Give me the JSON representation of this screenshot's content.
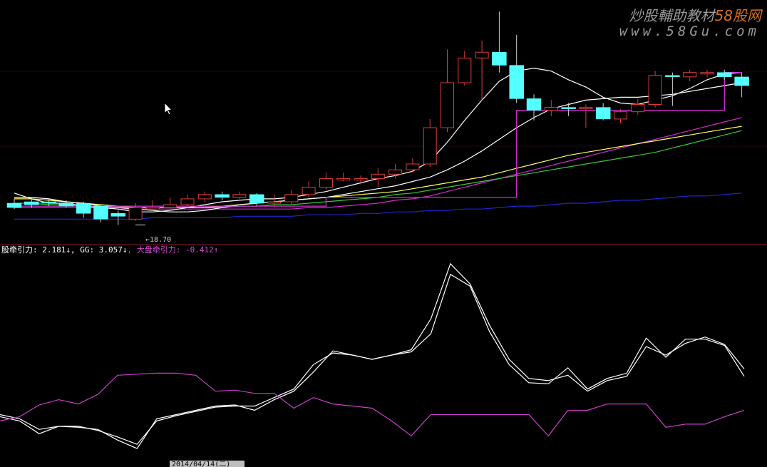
{
  "watermark": {
    "brand_prefix": "炒股輔助教材",
    "brand_suffix": "58股网",
    "url": "www.58Gu.com"
  },
  "indicator_legend": {
    "item1": "股牵引力: 2.181↓",
    "item2": ", GG: 3.057↓",
    "item3": ", 大盘牵引力: -0.412↑"
  },
  "low_price_label": "18.70",
  "date_box": "2014/04/14(二)",
  "colors": {
    "background": "#000000",
    "up_candle": "#e03c3c",
    "down_candle": "#54ffff",
    "ma_short": "#ffffff",
    "ma_mid": "#ffffff",
    "ma_yellow": "#ffff66",
    "ma_green": "#3cc83c",
    "ma_purple": "#d02ed0",
    "ma_blue": "#2424d4",
    "pane_divider": "#8a1a3a",
    "indicator_magenta": "#c840c8"
  },
  "chart_data": [
    {
      "type": "candlestick",
      "series": [
        {
          "name": "candles",
          "open": [
            20.2,
            20.3,
            20.3,
            20.2,
            20.2,
            20.0,
            19.5,
            19.1,
            19.9,
            19.9,
            20.1,
            20.5,
            20.8,
            20.6,
            20.8,
            20.2,
            20.3,
            20.8,
            21.3,
            21.9,
            21.9,
            21.9,
            22.2,
            22.5,
            22.9,
            25.4,
            28.5,
            30.2,
            30.6,
            29.7,
            27.4,
            26.6,
            26.8,
            26.7,
            26.8,
            26.0,
            26.5,
            27.0,
            29.0,
            28.9,
            29.2,
            29.2,
            28.9
          ],
          "close": [
            19.9,
            20.1,
            20.2,
            20.0,
            19.5,
            19.1,
            19.3,
            19.9,
            19.9,
            20.1,
            20.5,
            20.8,
            20.6,
            20.8,
            20.2,
            20.3,
            20.8,
            21.3,
            21.9,
            21.9,
            21.9,
            22.2,
            22.5,
            22.9,
            25.4,
            28.5,
            30.2,
            30.6,
            29.7,
            27.4,
            26.6,
            26.8,
            26.7,
            26.8,
            26.0,
            26.5,
            27.0,
            29.0,
            28.9,
            29.2,
            29.2,
            28.9,
            28.3
          ],
          "high": [
            20.5,
            20.6,
            20.5,
            20.4,
            20.3,
            20.1,
            19.7,
            20.2,
            20.4,
            20.6,
            20.8,
            21.0,
            21.0,
            21.0,
            20.9,
            20.8,
            21.1,
            21.7,
            22.3,
            22.3,
            22.1,
            22.6,
            22.9,
            23.3,
            26.0,
            30.8,
            30.7,
            31.4,
            33.4,
            31.8,
            27.7,
            27.3,
            27.1,
            27.0,
            27.1,
            26.7,
            27.4,
            29.3,
            29.2,
            29.4,
            29.4,
            29.4,
            29.2
          ],
          "low": [
            19.8,
            19.9,
            20.0,
            19.9,
            19.2,
            18.9,
            18.7,
            19.0,
            19.7,
            19.8,
            20.0,
            20.3,
            20.4,
            20.5,
            20.0,
            19.9,
            20.1,
            20.6,
            21.1,
            21.7,
            21.5,
            21.3,
            21.9,
            22.3,
            22.7,
            25.1,
            28.3,
            27.3,
            29.2,
            27.1,
            25.9,
            26.2,
            26.2,
            25.4,
            25.9,
            25.7,
            26.3,
            26.8,
            26.9,
            28.6,
            28.9,
            28.7,
            27.5
          ]
        },
        {
          "name": "ma_white_short",
          "values": [
            20.9,
            20.5,
            20.2,
            20.2,
            20.0,
            19.9,
            19.8,
            19.6,
            19.6,
            19.7,
            19.9,
            20.1,
            20.3,
            20.4,
            20.5,
            20.5,
            20.6,
            20.8,
            21.0,
            21.3,
            21.6,
            21.9,
            22.1,
            22.4,
            23.1,
            24.4,
            25.9,
            27.3,
            28.6,
            29.3,
            29.5,
            29.3,
            28.7,
            28.2,
            27.5,
            27.1,
            27.0,
            27.3,
            27.6,
            28.1,
            28.7,
            29.1,
            29.2
          ]
        },
        {
          "name": "ma_white_mid",
          "values": [
            20.6,
            20.6,
            20.5,
            20.3,
            20.2,
            20.0,
            19.9,
            19.8,
            19.7,
            19.6,
            19.6,
            19.7,
            19.9,
            20.1,
            20.2,
            20.3,
            20.4,
            20.5,
            20.6,
            20.8,
            21.0,
            21.2,
            21.4,
            21.7,
            22.0,
            22.5,
            23.1,
            23.8,
            24.6,
            25.4,
            26.1,
            26.7,
            27.0,
            27.3,
            27.4,
            27.5,
            27.5,
            27.6,
            27.7,
            27.9,
            28.1,
            28.3,
            28.5
          ]
        },
        {
          "name": "ma_yellow",
          "values": [
            20.5,
            20.5,
            20.4,
            20.3,
            20.2,
            20.1,
            20.0,
            19.9,
            19.9,
            19.9,
            19.9,
            19.9,
            20.0,
            20.1,
            20.2,
            20.3,
            20.4,
            20.5,
            20.6,
            20.7,
            20.8,
            20.9,
            21.0,
            21.2,
            21.4,
            21.6,
            21.8,
            22.0,
            22.3,
            22.6,
            22.9,
            23.2,
            23.5,
            23.7,
            23.9,
            24.1,
            24.3,
            24.5,
            24.7,
            24.9,
            25.1,
            25.3,
            25.5
          ]
        },
        {
          "name": "ma_green",
          "values": [
            20.2,
            20.2,
            20.1,
            20.1,
            20.0,
            20.0,
            20.0,
            19.9,
            19.9,
            19.9,
            19.9,
            19.9,
            19.9,
            20.0,
            20.0,
            20.1,
            20.1,
            20.2,
            20.3,
            20.4,
            20.5,
            20.6,
            20.8,
            20.9,
            21.1,
            21.3,
            21.5,
            21.7,
            21.9,
            22.1,
            22.3,
            22.5,
            22.7,
            22.9,
            23.1,
            23.3,
            23.5,
            23.7,
            24.0,
            24.3,
            24.6,
            24.9,
            25.2
          ]
        },
        {
          "name": "ma_purple",
          "values": [
            19.9,
            19.9,
            19.9,
            19.9,
            19.9,
            19.9,
            19.8,
            19.8,
            19.8,
            19.8,
            19.8,
            19.8,
            19.8,
            19.8,
            19.8,
            19.8,
            19.8,
            19.9,
            19.9,
            20.0,
            20.1,
            20.2,
            20.4,
            20.5,
            20.7,
            21.0,
            21.3,
            21.6,
            21.9,
            22.2,
            22.5,
            22.8,
            23.1,
            23.4,
            23.7,
            24.0,
            24.3,
            24.6,
            24.9,
            25.2,
            25.5,
            25.8,
            26.1
          ]
        },
        {
          "name": "ma_blue",
          "values": [
            19.1,
            19.1,
            19.1,
            19.1,
            19.1,
            19.1,
            19.1,
            19.1,
            19.2,
            19.2,
            19.2,
            19.2,
            19.2,
            19.3,
            19.3,
            19.3,
            19.3,
            19.4,
            19.4,
            19.4,
            19.5,
            19.5,
            19.6,
            19.6,
            19.7,
            19.7,
            19.8,
            19.8,
            19.9,
            20.0,
            20.0,
            20.1,
            20.2,
            20.2,
            20.3,
            20.4,
            20.4,
            20.5,
            20.6,
            20.7,
            20.7,
            20.8,
            20.9
          ]
        },
        {
          "name": "step_line",
          "values": [
            20.0,
            20.0,
            20.0,
            20.0,
            20.0,
            20.0,
            20.0,
            20.0,
            20.0,
            20.0,
            20.0,
            20.0,
            20.0,
            20.0,
            20.0,
            20.0,
            20.0,
            20.0,
            20.6,
            20.6,
            20.6,
            20.6,
            20.6,
            20.6,
            20.6,
            20.6,
            20.6,
            20.6,
            20.6,
            26.6,
            26.6,
            26.6,
            26.6,
            26.6,
            26.6,
            26.6,
            26.6,
            26.6,
            26.6,
            26.6,
            26.6,
            29.2,
            29.2
          ]
        }
      ],
      "ylim": [
        17.5,
        34.0
      ]
    },
    {
      "type": "line",
      "series": [
        {
          "name": "股牵引力",
          "values": [
            -1.6,
            -2.0,
            -3.2,
            -2.5,
            -2.6,
            -2.8,
            -3.8,
            -4.6,
            -1.8,
            -1.4,
            -1.0,
            -0.6,
            -0.5,
            -1.0,
            0.0,
            0.8,
            2.6,
            4.6,
            4.2,
            3.8,
            4.2,
            4.5,
            6.2,
            11.8,
            10.7,
            6.4,
            3.3,
            1.6,
            1.5,
            3.0,
            1.0,
            2.0,
            2.5,
            5.8,
            4.0,
            5.7,
            5.7,
            5.1,
            2.2
          ]
        },
        {
          "name": "GG",
          "values": [
            -1.4,
            -1.8,
            -2.8,
            -2.5,
            -2.5,
            -2.9,
            -3.5,
            -4.2,
            -2.0,
            -1.5,
            -1.1,
            -0.7,
            -0.6,
            -0.6,
            0.2,
            1.0,
            3.3,
            4.4,
            4.2,
            3.8,
            4.2,
            4.7,
            7.6,
            12.8,
            10.9,
            7.0,
            3.8,
            2.0,
            1.8,
            2.3,
            0.8,
            1.8,
            2.2,
            5.0,
            4.2,
            5.3,
            5.9,
            5.2,
            2.9
          ]
        },
        {
          "name": "大盘牵引力",
          "values": [
            -2.0,
            -1.6,
            -0.5,
            0.0,
            -0.4,
            0.5,
            2.3,
            2.4,
            2.5,
            2.5,
            2.3,
            0.8,
            0.9,
            0.6,
            0.6,
            -0.8,
            0.2,
            -0.4,
            -0.6,
            -0.8,
            -2.0,
            -3.4,
            -1.4,
            -1.4,
            -1.4,
            -1.4,
            -1.4,
            -1.4,
            -3.4,
            -1.0,
            -1.0,
            -0.4,
            -0.4,
            -0.4,
            -2.6,
            -2.3,
            -2.3,
            -1.6,
            -1.0
          ]
        }
      ],
      "ylim": [
        -6.0,
        14.0
      ]
    }
  ]
}
